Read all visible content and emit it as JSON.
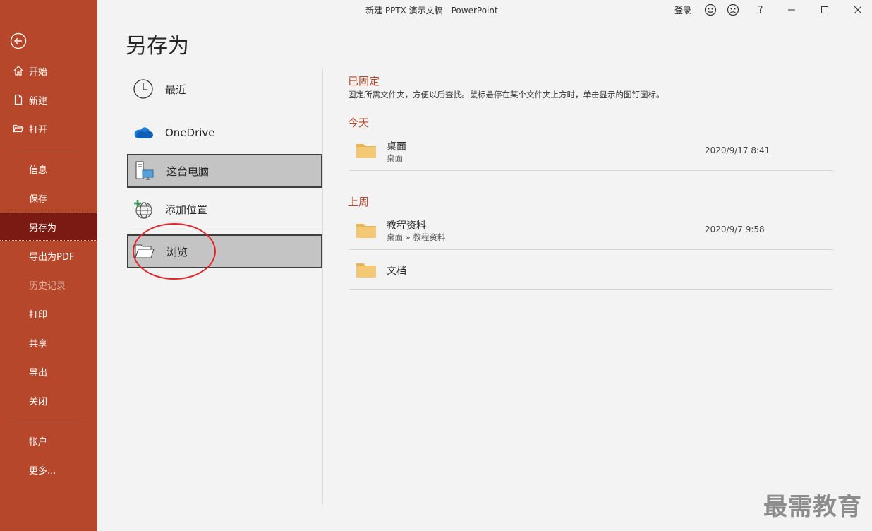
{
  "window": {
    "title": "新建 PPTX 演示文稿  -  PowerPoint",
    "login": "登录",
    "buttons": [
      "smile-icon",
      "frown-icon",
      "help-icon",
      "minimize-icon",
      "maximize-icon",
      "close-icon"
    ],
    "help_glyph": "?"
  },
  "nav": {
    "items": [
      {
        "label": "开始"
      },
      {
        "label": "新建"
      },
      {
        "label": "打开"
      },
      {
        "label": "信息"
      },
      {
        "label": "保存"
      },
      {
        "label": "另存为"
      },
      {
        "label": "导出为PDF"
      },
      {
        "label": "历史记录"
      },
      {
        "label": "打印"
      },
      {
        "label": "共享"
      },
      {
        "label": "导出"
      },
      {
        "label": "关闭"
      },
      {
        "label": "帐户"
      },
      {
        "label": "更多..."
      }
    ],
    "active_item": "另存为",
    "disabled_item": "历史记录"
  },
  "page": {
    "title": "另存为"
  },
  "locations": [
    {
      "label": "最近",
      "icon": "clock-icon"
    },
    {
      "label": "OneDrive",
      "icon": "cloud-icon"
    },
    {
      "label": "这台电脑",
      "icon": "computer-icon",
      "selected": true
    },
    {
      "label": "添加位置",
      "icon": "add-location-icon"
    },
    {
      "label": "浏览",
      "icon": "folder-open-icon",
      "selected": true
    }
  ],
  "pinned": {
    "heading": "已固定",
    "description": "固定所需文件夹，方便以后查找。鼠标悬停在某个文件夹上方时，单击显示的图钉图标。"
  },
  "today": {
    "heading": "今天",
    "folders": [
      {
        "name": "桌面",
        "path": "桌面",
        "date": "2020/9/17 8:41"
      }
    ]
  },
  "last_week": {
    "heading": "上周",
    "folders": [
      {
        "name": "教程资料",
        "path": "桌面 » 教程资料",
        "date": "2020/9/7 9:58"
      },
      {
        "name": "文档",
        "path": "",
        "date": ""
      }
    ]
  },
  "watermark": "最需教育",
  "colors": {
    "nav_bg": "#b7472a",
    "nav_active": "#7a1a12",
    "accent": "#b7472a",
    "folder": "#f0c36b",
    "highlight_circle": "#e0262a"
  }
}
